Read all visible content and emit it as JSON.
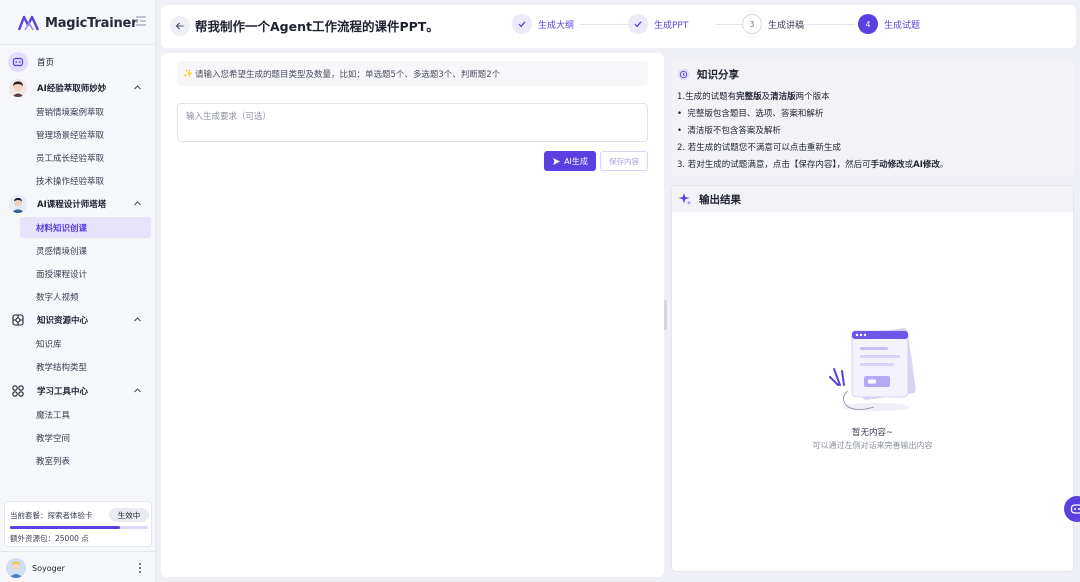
{
  "sidebar": {
    "brand": "MagicTrainer",
    "home": "首页",
    "sections": [
      {
        "label": "AI经验萃取师妙妙",
        "items": [
          "营销情境案例萃取",
          "管理场景经验萃取",
          "员工成长经验萃取",
          "技术操作经验萃取"
        ]
      },
      {
        "label": "AI课程设计师塔塔",
        "items": [
          "材料知识创课",
          "灵感情境创课",
          "面授课程设计",
          "数字人视频"
        ]
      },
      {
        "label": "知识资源中心",
        "items": [
          "知识库",
          "教学结构类型"
        ]
      },
      {
        "label": "学习工具中心",
        "items": [
          "魔法工具",
          "教学空间",
          "教室列表"
        ]
      }
    ],
    "active_item": "材料知识创课",
    "plan": {
      "label": "当前套餐：探索者体验卡",
      "status": "生效中",
      "progress": 0.8,
      "extra": "额外资源包：25000 点"
    },
    "user": {
      "name": "Soyoger"
    }
  },
  "header": {
    "title": "帮我制作一个Agent工作流程的课件PPT。",
    "steps": [
      {
        "num": "",
        "label": "生成大纲",
        "state": "done"
      },
      {
        "num": "",
        "label": "生成PPT",
        "state": "done"
      },
      {
        "num": "3",
        "label": "生成讲稿",
        "state": "pending"
      },
      {
        "num": "4",
        "label": "生成试题",
        "state": "current"
      }
    ]
  },
  "left": {
    "tip_icon": "✨",
    "tip": "请输入您希望生成的题目类型及数量，比如：单选题5个、多选题3个、判断题2个",
    "input_value": "",
    "input_placeholder": "输入生成要求（可选）",
    "ai_button": "AI生成",
    "save_button": "保存内容"
  },
  "knowledge": {
    "title": "知识分享",
    "line1": {
      "a": "1.生成的试题有",
      "b": "完整版",
      "c": "及",
      "d": "清洁版",
      "e": "两个版本"
    },
    "bullet1": "完整版包含题目、选项、答案和解析",
    "bullet2": "清洁版不包含答案及解析",
    "line2": "2. 若生成的试题您不满意可以点击重新生成",
    "line3": {
      "a": "3. 若对生成的试题满意，点击【保存内容】，然后可",
      "b": "手动修改",
      "c": "或",
      "d": "AI修改",
      "e": "。"
    }
  },
  "output": {
    "title": "输出结果",
    "empty_title": "暂无内容~",
    "empty_sub": "可以通过左侧对话来完善输出内容"
  },
  "colors": {
    "accent": "#5b3fe0",
    "accent_light": "#e7e3fb",
    "bg": "#eef0f6"
  }
}
